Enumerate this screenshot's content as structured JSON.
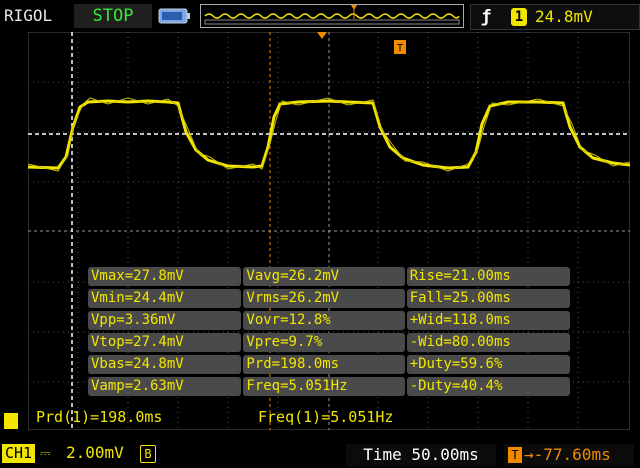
{
  "header": {
    "brand": "RIGOL",
    "run_status": "STOP",
    "trigger": {
      "edge_icon": "rising-edge-icon",
      "source": "1",
      "level": "24.8mV"
    }
  },
  "colors": {
    "channel1": "#f2e600",
    "trigger_marker": "#f08a00",
    "status": "#39e639",
    "panel": "#4a4a4a"
  },
  "measurements": {
    "rows": [
      [
        "Vmax=27.8mV",
        "Vavg=26.2mV",
        "Rise=21.00ms"
      ],
      [
        "Vmin=24.4mV",
        "Vrms=26.2mV",
        "Fall=25.00ms"
      ],
      [
        "Vpp=3.36mV",
        "Vovr=12.8%",
        "+Wid=118.0ms"
      ],
      [
        "Vtop=27.4mV",
        "Vpre=9.7%",
        "-Wid=80.00ms"
      ],
      [
        "Vbas=24.8mV",
        "Prd=198.0ms",
        "+Duty=59.6%"
      ],
      [
        "Vamp=2.63mV",
        "Freq=5.051Hz",
        "-Duty=40.4%"
      ]
    ],
    "prd": "Prd(1)=198.0ms",
    "freq": "Freq(1)=5.051Hz"
  },
  "footer": {
    "channel": "CH1",
    "coupling_icon": "dc-coupling-icon",
    "scale": "2.00mV",
    "bw_limit": "B",
    "timebase": "Time 50.00ms",
    "delay": "-77.60ms"
  }
}
